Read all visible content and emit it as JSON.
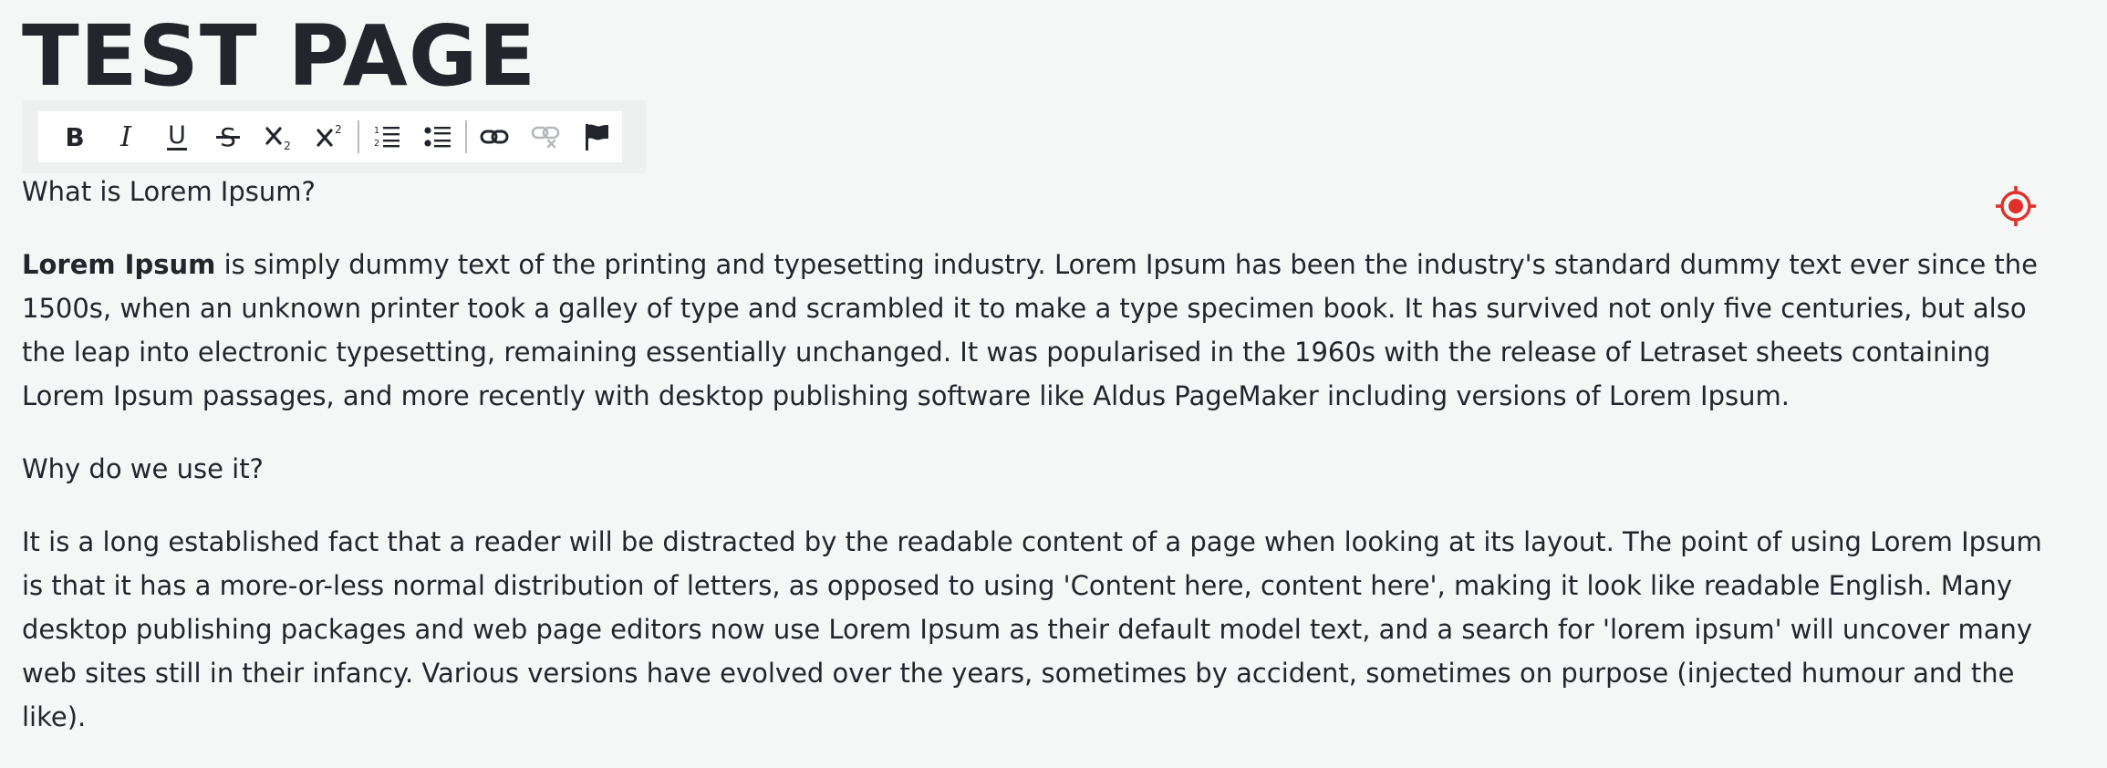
{
  "page": {
    "title": "TEST PAGE"
  },
  "toolbar": {
    "buttons": [
      {
        "name": "bold-button",
        "icon": "bold-icon",
        "glyph": "B"
      },
      {
        "name": "italic-button",
        "icon": "italic-icon",
        "glyph": "I"
      },
      {
        "name": "underline-button",
        "icon": "underline-icon",
        "glyph": "U"
      },
      {
        "name": "strikethrough-button",
        "icon": "strikethrough-icon",
        "glyph": "S"
      },
      {
        "name": "subscript-button",
        "icon": "subscript-icon"
      },
      {
        "name": "superscript-button",
        "icon": "superscript-icon"
      },
      {
        "name": "ordered-list-button",
        "icon": "ordered-list-icon"
      },
      {
        "name": "bullet-list-button",
        "icon": "bullet-list-icon"
      },
      {
        "name": "link-button",
        "icon": "link-icon"
      },
      {
        "name": "unlink-button",
        "icon": "unlink-icon",
        "disabled": true
      },
      {
        "name": "flag-button",
        "icon": "flag-icon"
      }
    ]
  },
  "content": {
    "heading1": "What is Lorem Ipsum?",
    "para1_bold": "Lorem Ipsum",
    "para1_rest": " is simply dummy text of the printing and typesetting industry. Lorem Ipsum has been the industry's standard dummy text ever since the 1500s, when an unknown printer took a galley of type and scrambled it to make a type specimen book. It has survived not only five centuries, but also the leap into electronic typesetting, remaining essentially unchanged. It was popularised in the 1960s with the release of Letraset sheets containing Lorem Ipsum passages, and more recently with desktop publishing software like Aldus PageMaker including versions of Lorem Ipsum.",
    "heading2": "Why do we use it?",
    "para2": "It is a long established fact that a reader will be distracted by the readable content of a page when looking at its layout. The point of using Lorem Ipsum is that it has a more-or-less normal distribution of letters, as opposed to using 'Content here, content here', making it look like readable English. Many desktop publishing packages and web page editors now use Lorem Ipsum as their default model text, and a search for 'lorem ipsum' will uncover many web sites still in their infancy. Various versions have evolved over the years, sometimes by accident, sometimes on purpose (injected humour and the like)."
  },
  "colors": {
    "background": "#f5f7f6",
    "text": "#22262c",
    "target": "#e0302a",
    "disabled_icon": "#b5b8bb"
  },
  "overlay": {
    "icon": "target-icon"
  }
}
